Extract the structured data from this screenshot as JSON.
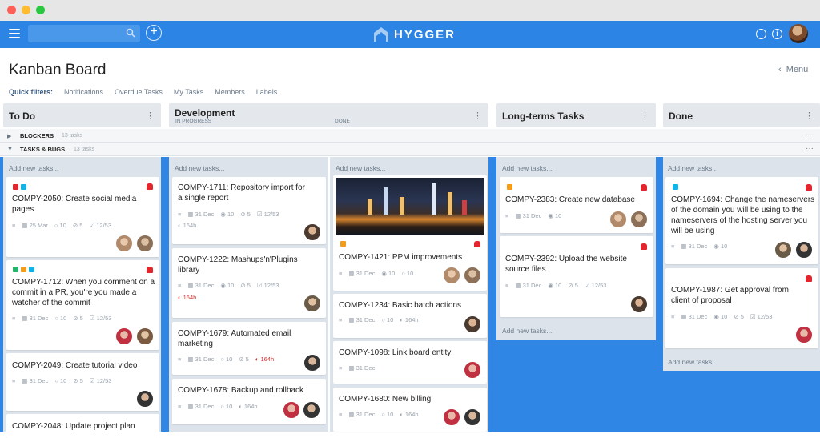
{
  "window_dots": [
    "#ff5f57",
    "#febc2e",
    "#28c840"
  ],
  "topbar": {
    "logo": "HYGGER",
    "brand_color": "#2c84e4"
  },
  "page": {
    "title": "Kanban Board",
    "menu_label": "Menu"
  },
  "filters": {
    "label": "Quick filters:",
    "items": [
      "Notifications",
      "Overdue Tasks",
      "My Tasks",
      "Members",
      "Labels"
    ]
  },
  "columns": {
    "todo": "To Do",
    "dev": "Development",
    "dev_in_progress": "IN PROGRESS",
    "dev_done": "DONE",
    "longterm": "Long-terms Tasks",
    "done": "Done"
  },
  "swimlanes": {
    "blockers": {
      "label": "BLOCKERS",
      "count": "13 tasks"
    },
    "tasks": {
      "label": "TASKS & BUGS",
      "count": "13 tasks"
    }
  },
  "add_new": "Add new tasks...",
  "cards": {
    "c2050": {
      "title": "COMPY-2050: Create social media pages",
      "date": "25 Mar",
      "comments": "10",
      "attach": "5",
      "checks": "12/53"
    },
    "c1712": {
      "title": "COMPY-1712: When you comment on a commit in a PR, you're you made a watcher of the commit",
      "date": "31 Dec",
      "comments": "10",
      "attach": "5",
      "checks": "12/53"
    },
    "c2049": {
      "title": "COMPY-2049: Create tutorial video",
      "date": "31 Dec",
      "comments": "10",
      "attach": "5",
      "checks": "12/53"
    },
    "c2048": {
      "title": "COMPY-2048: Update project plan"
    },
    "c1711": {
      "title": "COMPY-1711: Repository import for a single report",
      "date": "31 Dec",
      "views": "10",
      "attach": "5",
      "checks": "12/53",
      "time": "164h"
    },
    "c1222": {
      "title": "COMPY-1222: Mashups'n'Plugins library",
      "date": "31 Dec",
      "views": "10",
      "attach": "5",
      "checks": "12/53",
      "time": "164h"
    },
    "c1679": {
      "title": "COMPY-1679: Automated email marketing",
      "date": "31 Dec",
      "comments": "10",
      "attach": "5",
      "time": "164h"
    },
    "c1678": {
      "title": "COMPY-1678: Backup and rollback",
      "date": "31 Dec",
      "comments": "10",
      "time": "164h"
    },
    "c1421": {
      "title": "COMPY-1421: PPM improvements",
      "date": "31 Dec",
      "views": "10",
      "comments": "10"
    },
    "c1234": {
      "title": "COMPY-1234: Basic batch actions",
      "date": "31 Dec",
      "comments": "10",
      "time": "164h"
    },
    "c1098": {
      "title": "COMPY-1098: Link board entity",
      "date": "31 Dec"
    },
    "c1680": {
      "title": "COMPY-1680: New billing",
      "date": "31 Dec",
      "comments": "10",
      "time": "164h"
    },
    "c2383": {
      "title": "COMPY-2383: Create new database",
      "date": "31 Dec",
      "views": "10"
    },
    "c2392": {
      "title": "COMPY-2392: Upload the website source files",
      "date": "31 Dec",
      "views": "10",
      "attach": "5",
      "checks": "12/53"
    },
    "c1694": {
      "title": "COMPY-1694: Change the nameservers of the domain you will be using to the nameservers of the hosting server you will be using",
      "date": "31 Dec",
      "views": "10"
    },
    "c1987": {
      "title": "COMPY-1987: Get approval from client of proposal",
      "date": "31 Dec",
      "views": "10",
      "attach": "5",
      "checks": "12/53"
    }
  }
}
